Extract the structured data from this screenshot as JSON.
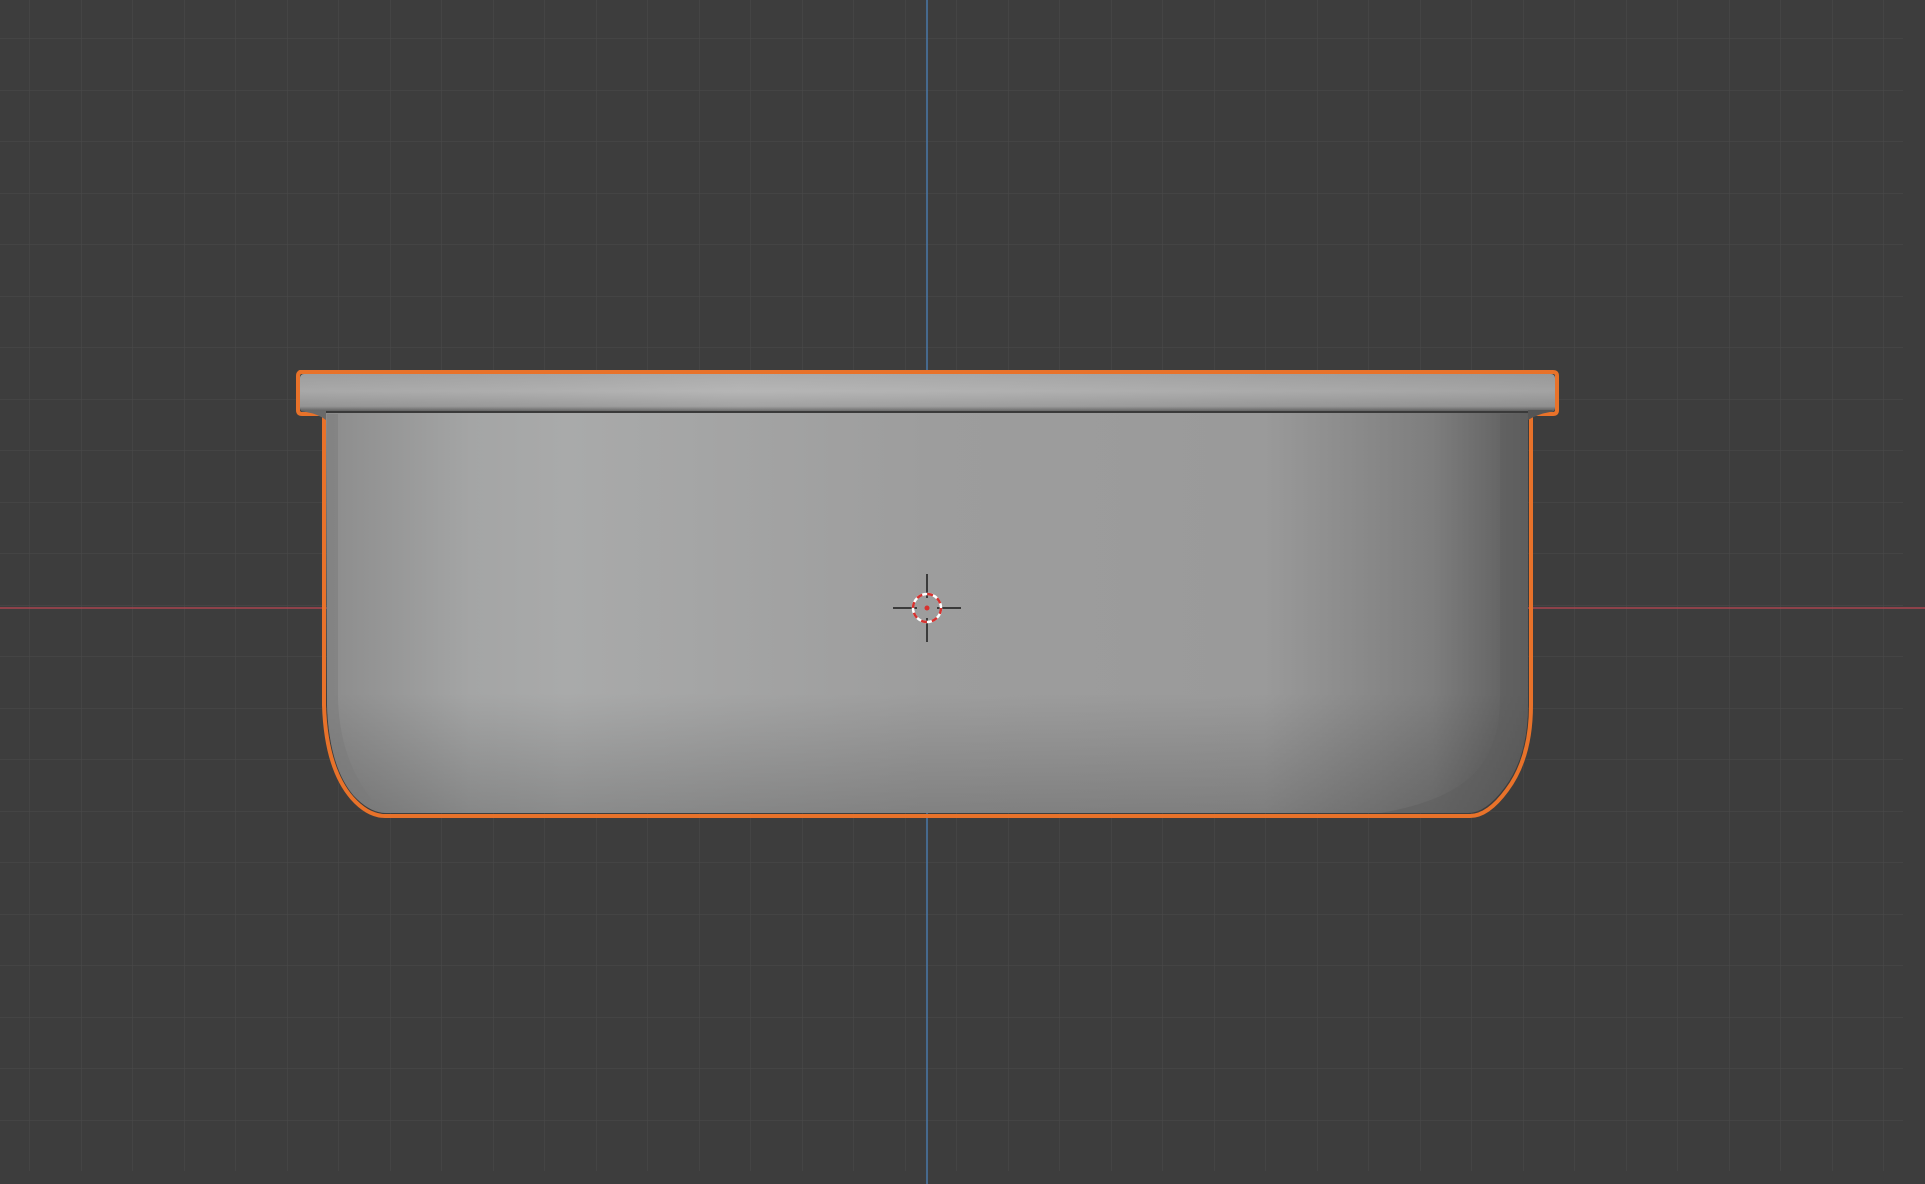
{
  "viewport": {
    "view": "orthographic-front",
    "background_color": "#3d3d3d",
    "grid_color": "#4a4a4a",
    "x_axis_color": "#a8454f",
    "z_axis_color": "#4a78a8",
    "grid_visible": true
  },
  "object": {
    "type": "mesh",
    "shape": "rounded-tub",
    "selected": true,
    "outline_color": "#e8722a",
    "surface_colors": [
      "#8d8d8d",
      "#a8a9a9",
      "#9a9a9a",
      "#6e6e6e"
    ]
  },
  "cursor_3d": {
    "icon": "3d-cursor-icon",
    "ring_colors": [
      "#d7322f",
      "#ffffff"
    ]
  }
}
